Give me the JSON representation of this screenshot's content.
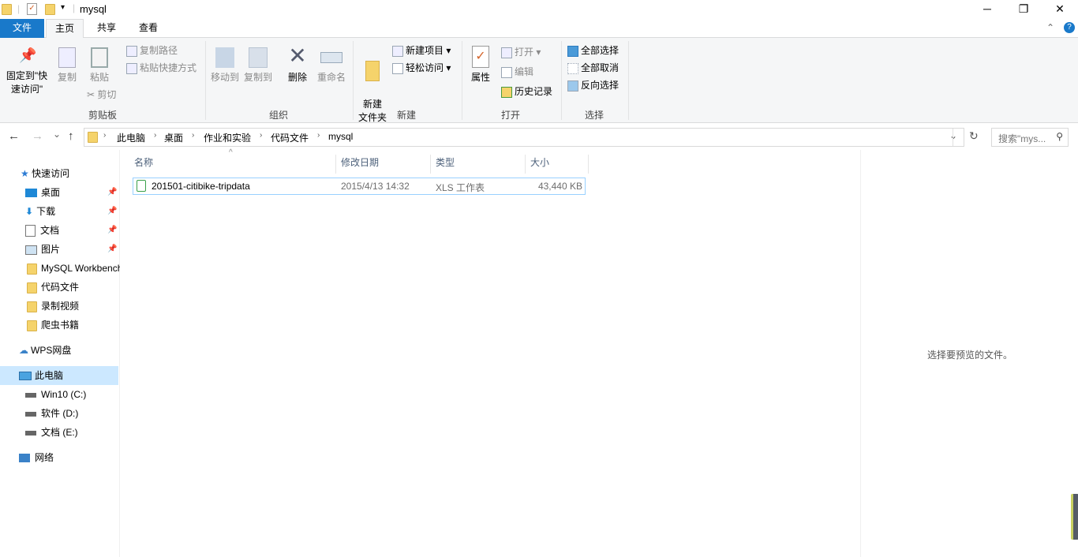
{
  "window": {
    "title": "mysql",
    "minimize": "─",
    "maximize": "❐",
    "close": "✕",
    "help": "?",
    "collapse": "⌃"
  },
  "tabs": [
    {
      "label": "文件"
    },
    {
      "label": "主页"
    },
    {
      "label": "共享"
    },
    {
      "label": "查看"
    }
  ],
  "ribbon": {
    "clipboard": {
      "label": "剪贴板",
      "pin": "固定到\"快速访问\"",
      "copy": "复制",
      "paste": "粘贴",
      "copy_path": "复制路径",
      "paste_shortcut": "粘贴快捷方式",
      "cut": "剪切"
    },
    "organize": {
      "label": "组织",
      "move_to": "移动到",
      "copy_to": "复制到",
      "delete": "删除",
      "rename": "重命名"
    },
    "new": {
      "label": "新建",
      "new_folder": "新建\n文件夹",
      "new_item": "新建项目 ▾",
      "easy_access": "轻松访问 ▾"
    },
    "open": {
      "label": "打开",
      "properties": "属性",
      "open": "打开 ▾",
      "edit": "编辑",
      "history": "历史记录"
    },
    "select": {
      "label": "选择",
      "select_all": "全部选择",
      "select_none": "全部取消",
      "invert": "反向选择"
    }
  },
  "address": {
    "breadcrumbs": [
      "此电脑",
      "桌面",
      "作业和实验",
      "代码文件",
      "mysql"
    ],
    "search_placeholder": "搜索\"mys...",
    "back": "←",
    "forward": "→",
    "recent": "⌄",
    "up": "↑",
    "refresh": "↻",
    "dropdown": "⌄"
  },
  "sidebar": {
    "items": [
      {
        "label": "快速访问",
        "icon": "star-icon"
      },
      {
        "label": "桌面",
        "icon": "desktop-icon",
        "pinned": true
      },
      {
        "label": "下载",
        "icon": "download-icon",
        "pinned": true
      },
      {
        "label": "文档",
        "icon": "document-icon",
        "pinned": true
      },
      {
        "label": "图片",
        "icon": "picture-icon",
        "pinned": true
      },
      {
        "label": "MySQL Workbench",
        "icon": "folder-icon"
      },
      {
        "label": "代码文件",
        "icon": "folder-icon"
      },
      {
        "label": "录制视频",
        "icon": "folder-icon"
      },
      {
        "label": "爬虫书籍",
        "icon": "folder-icon"
      },
      {
        "label": "WPS网盘",
        "icon": "cloud-icon"
      },
      {
        "label": "此电脑",
        "icon": "computer-icon"
      },
      {
        "label": "Win10 (C:)",
        "icon": "drive-icon"
      },
      {
        "label": "软件 (D:)",
        "icon": "drive-icon"
      },
      {
        "label": "文档 (E:)",
        "icon": "drive-icon"
      },
      {
        "label": "网络",
        "icon": "network-icon"
      }
    ]
  },
  "columns": [
    "名称",
    "修改日期",
    "类型",
    "大小"
  ],
  "files": [
    {
      "name": "201501-citibike-tripdata",
      "modified": "2015/4/13 14:32",
      "type": "XLS 工作表",
      "size": "43,440 KB"
    }
  ],
  "preview": {
    "message": "选择要预览的文件。"
  }
}
